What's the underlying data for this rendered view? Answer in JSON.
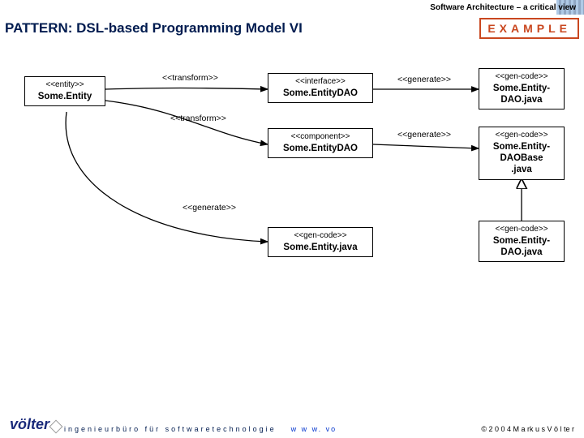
{
  "header": {
    "breadcrumb": "Software Architecture – a critical view"
  },
  "title": "PATTERN: DSL-based Programming Model VI",
  "example_badge": "EXAMPLE",
  "nodes": {
    "entity": {
      "stereo": "<<entity>>",
      "main": "Some.Entity"
    },
    "ifaceDAO": {
      "stereo": "<<interface>>",
      "main": "Some.EntityDAO"
    },
    "compDAO": {
      "stereo": "<<component>>",
      "main": "Some.EntityDAO"
    },
    "entityJava": {
      "stereo": "<<gen-code>>",
      "main": "Some.Entity.java"
    },
    "entityDAOjava": {
      "stereo": "<<gen-code>>",
      "main": "Some.Entity-\nDAO.java"
    },
    "entityDAOBase": {
      "stereo": "<<gen-code>>",
      "main": "Some.Entity-\nDAOBase\n.java"
    },
    "entityDAOjava2": {
      "stereo": "<<gen-code>>",
      "main": "Some.Entity-\nDAO.java"
    }
  },
  "edges": {
    "t1": "<<transform>>",
    "t2": "<<transform>>",
    "g1": "<<generate>>",
    "g2": "<<generate>>",
    "g3": "<<generate>>"
  },
  "footer": {
    "logo": "völter",
    "tagline": "ingenieurbüro  für  softwaretechnologie",
    "url": "w w w. vo",
    "copyright": "© 2 0 0 4   M a rk u s  V ö l te r"
  }
}
